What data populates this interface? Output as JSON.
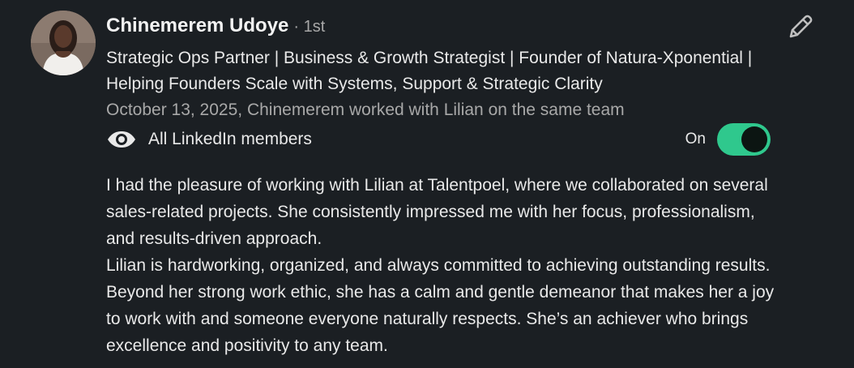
{
  "recommendation": {
    "author_name": "Chinemerem Udoye",
    "connection_degree": "· 1st",
    "headline": "Strategic Ops Partner | Business & Growth Strategist | Founder of Natura-Xponential | Helping Founders Scale with Systems, Support & Strategic Clarity",
    "meta": "October 13, 2025, Chinemerem worked with Lilian on the same team",
    "visibility": {
      "icon": "eye-icon",
      "label": "All LinkedIn members",
      "toggle_status": "On",
      "toggle_on": true,
      "toggle_color": "#2fc88d"
    },
    "edit_icon": "pencil-icon",
    "paragraphs": [
      "I had the pleasure of working with Lilian at Talentpoel, where we collaborated on several sales-related projects. She consistently impressed me with her focus, professionalism, and results-driven approach.",
      "Lilian is hardworking, organized, and always committed to achieving outstanding results. Beyond her strong work ethic, she has a calm and gentle demeanor that makes her a joy to work with and someone everyone naturally respects. She’s an achiever who brings excellence and positivity to any team."
    ]
  }
}
